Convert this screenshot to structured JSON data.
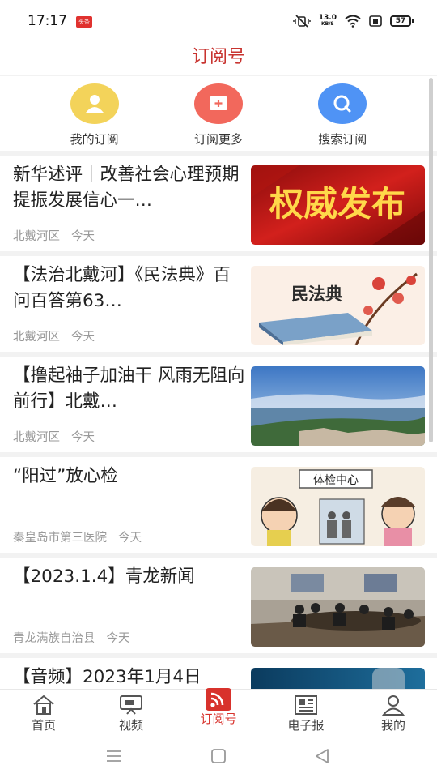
{
  "status_bar": {
    "time": "17:17",
    "app_icon_text": "头条",
    "net_speed": "13.0",
    "net_speed_unit": "KB/S",
    "battery": "57"
  },
  "header": {
    "title": "订阅号"
  },
  "shortcuts": [
    {
      "label": "我的订阅",
      "icon": "person-icon",
      "color": "#f3d35a"
    },
    {
      "label": "订阅更多",
      "icon": "add-subscription-icon",
      "color": "#f2685c"
    },
    {
      "label": "搜索订阅",
      "icon": "search-icon",
      "color": "#4f93f5"
    }
  ],
  "news": [
    {
      "title": "新华述评｜改善社会心理预期提振发展信心一…",
      "source": "北戴河区",
      "time": "今天",
      "thumb_text": "权威发布"
    },
    {
      "title": "【法治北戴河】《民法典》百问百答第63…",
      "source": "北戴河区",
      "time": "今天",
      "thumb_text": "民法典"
    },
    {
      "title": "【撸起袖子加油干 风雨无阻向前行】北戴…",
      "source": "北戴河区",
      "time": "今天"
    },
    {
      "title": "“阳过”放心检",
      "source": "秦皇岛市第三医院",
      "time": "今天",
      "thumb_text": "体检中心"
    },
    {
      "title": "【2023.1.4】青龙新闻",
      "source": "青龙满族自治县",
      "time": "今天"
    },
    {
      "title": "【音频】2023年1月4日",
      "source": "",
      "time": ""
    }
  ],
  "bottom_nav": [
    {
      "label": "首页",
      "icon": "home-icon"
    },
    {
      "label": "视频",
      "icon": "video-icon"
    },
    {
      "label": "订阅号",
      "icon": "rss-icon",
      "active": true
    },
    {
      "label": "电子报",
      "icon": "newspaper-icon"
    },
    {
      "label": "我的",
      "icon": "profile-icon"
    }
  ],
  "colors": {
    "accent": "#d8322c",
    "title": "#c8332f",
    "meta": "#999999"
  }
}
